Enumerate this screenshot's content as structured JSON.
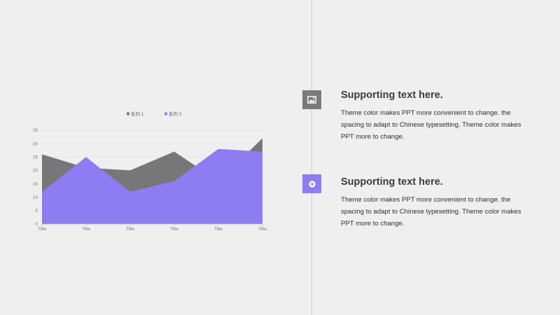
{
  "chart_data": {
    "type": "area",
    "categories": [
      "Title",
      "Title",
      "Title",
      "Title",
      "Title",
      "Title"
    ],
    "series": [
      {
        "name": "系列 1",
        "color": "#777777",
        "values": [
          26,
          21,
          20,
          27,
          16,
          32
        ]
      },
      {
        "name": "系列 2",
        "color": "#8e7cf2",
        "values": [
          12,
          25,
          12,
          16,
          28,
          27
        ]
      }
    ],
    "y_ticks": [
      0,
      5,
      10,
      15,
      20,
      25,
      30,
      35
    ],
    "ylim": [
      0,
      35
    ],
    "grid": true,
    "legend_position": "top"
  },
  "items": [
    {
      "icon": "image-icon",
      "title": "Supporting text here.",
      "text": "Theme color makes PPT more convenient to change. the spacing to adapt to Chinese typesetting. Theme color makes PPT more to change."
    },
    {
      "icon": "target-icon",
      "title": "Supporting text here.",
      "text": "Theme  color makes PPT more convenient to change. the spacing to adapt to Chinese typesetting. Theme  color makes PPT more to change."
    }
  ]
}
